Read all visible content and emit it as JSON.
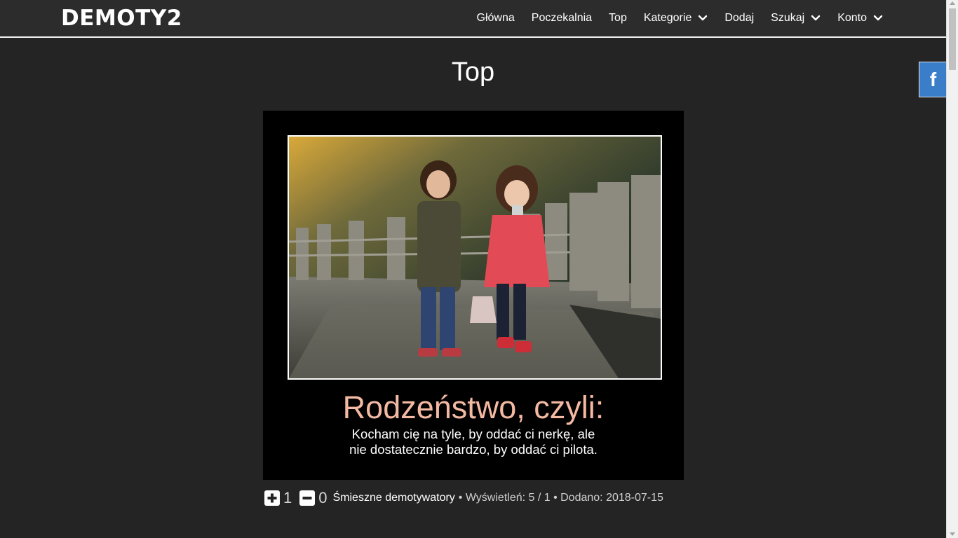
{
  "header": {
    "logo": "DEMOTY2",
    "nav": [
      {
        "label": "Główna",
        "dropdown": false
      },
      {
        "label": "Poczekalnia",
        "dropdown": false
      },
      {
        "label": "Top",
        "dropdown": false
      },
      {
        "label": "Kategorie",
        "dropdown": true
      },
      {
        "label": "Dodaj",
        "dropdown": false
      },
      {
        "label": "Szukaj",
        "dropdown": true
      },
      {
        "label": "Konto",
        "dropdown": true
      }
    ]
  },
  "side": {
    "facebook_label": "f"
  },
  "page": {
    "title": "Top"
  },
  "post": {
    "title": "Rodzeństwo, czyli:",
    "text": "Kocham cię na tyle, by oddać ci nerkę, ale nie dostatecznie bardzo, by oddać ci pilota.",
    "title_color": "#f4b9a2",
    "upvotes": "1",
    "downvotes": "0",
    "category": "Śmieszne demotywatory",
    "info": "• Wyświetleń: 5 / 1 • Dodano: 2018-07-15"
  },
  "colors": {
    "background": "#242424",
    "header": "#2c2c2c",
    "facebook": "#3a7dc9"
  },
  "icons": [
    "chevron-down-icon",
    "facebook-icon",
    "plus-icon",
    "minus-icon"
  ]
}
